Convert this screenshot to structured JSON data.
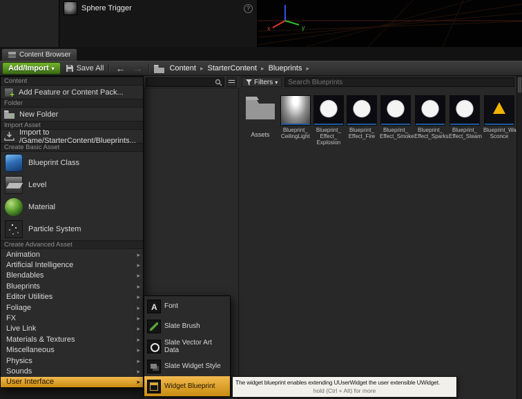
{
  "colors": {
    "accent_green": "#5a9e22",
    "highlight_orange": "#d89a2a",
    "axis_x": "#e0392c",
    "axis_y": "#2fbf2f",
    "axis_z": "#2f53e8",
    "blueprint_bar": "#1d5a9e"
  },
  "outliner": {
    "item_label": "Sphere Trigger"
  },
  "viewport": {
    "axis_x_label": "x",
    "axis_y_label": "y"
  },
  "content_browser": {
    "tab_label": "Content Browser",
    "toolbar": {
      "add_import_label": "Add/Import",
      "save_all_label": "Save All",
      "back_arrow": "←",
      "forward_arrow": "→",
      "breadcrumb": [
        {
          "label": "Content"
        },
        {
          "label": "StarterContent"
        },
        {
          "label": "Blueprints"
        }
      ]
    },
    "filters_label": "Filters",
    "search_placeholder": "Search Blueprints",
    "folder_label": "Assets",
    "assets": [
      {
        "line1": "Blueprint_",
        "line2": "CeilingLight",
        "line3": ""
      },
      {
        "line1": "Blueprint_",
        "line2": "Effect_",
        "line3": "Explosion"
      },
      {
        "line1": "Blueprint_",
        "line2": "Effect_Fire",
        "line3": ""
      },
      {
        "line1": "Blueprint_",
        "line2": "Effect_Smoke",
        "line3": ""
      },
      {
        "line1": "Blueprint_",
        "line2": "Effect_Sparks",
        "line3": ""
      },
      {
        "line1": "Blueprint_",
        "line2": "Effect_Steam",
        "line3": ""
      },
      {
        "line1": "Blueprint_Wall",
        "line2": "Sconce",
        "line3": ""
      }
    ]
  },
  "menu": {
    "content_header": "Content",
    "add_feature_label": "Add Feature or Content Pack...",
    "folder_header": "Folder",
    "new_folder_label": "New Folder",
    "import_header": "Import Asset",
    "import_label": "Import to /Game/StarterContent/Blueprints...",
    "basic_header": "Create Basic Asset",
    "basic_items": [
      {
        "label": "Blueprint Class"
      },
      {
        "label": "Level"
      },
      {
        "label": "Material"
      },
      {
        "label": "Particle System"
      }
    ],
    "advanced_header": "Create Advanced Asset",
    "advanced_items": [
      {
        "label": "Animation"
      },
      {
        "label": "Artificial Intelligence"
      },
      {
        "label": "Blendables"
      },
      {
        "label": "Blueprints"
      },
      {
        "label": "Editor Utilities"
      },
      {
        "label": "Foliage"
      },
      {
        "label": "FX"
      },
      {
        "label": "Live Link"
      },
      {
        "label": "Materials & Textures"
      },
      {
        "label": "Miscellaneous"
      },
      {
        "label": "Physics"
      },
      {
        "label": "Sounds"
      },
      {
        "label": "User Interface"
      }
    ]
  },
  "submenu": {
    "items": [
      {
        "label": "Font"
      },
      {
        "label": "Slate Brush"
      },
      {
        "label": "Slate Vector Art Data"
      },
      {
        "label": "Slate Widget Style"
      },
      {
        "label": "Widget Blueprint"
      }
    ]
  },
  "tooltip": {
    "text": "The widget blueprint enables extending UUserWidget the user extensible UWidget.",
    "hint": "hold (Ctrl + Alt) for more"
  }
}
